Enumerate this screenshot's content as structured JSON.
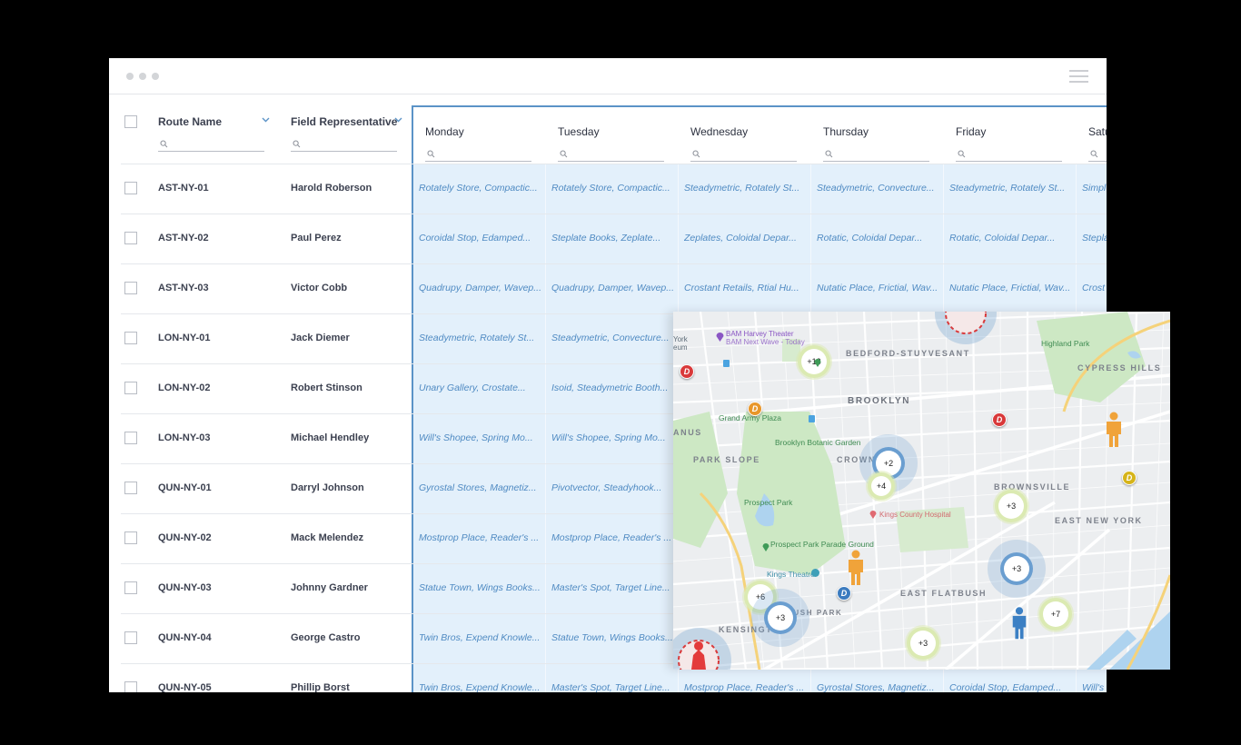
{
  "window": {
    "menu_icon": "hamburger-menu-icon"
  },
  "columns": {
    "route_name": "Route Name",
    "field_rep": "Field Representative",
    "days": [
      "Monday",
      "Tuesday",
      "Wednesday",
      "Thursday",
      "Friday",
      "Satu"
    ]
  },
  "rows": [
    {
      "route": "AST-NY-01",
      "rep": "Harold Roberson",
      "days": [
        "Rotately Store, Compactic...",
        "Rotately Store, Compactic...",
        "Steadymetric, Rotately St...",
        "Steadymetric, Convecture...",
        "Steadymetric, Rotately St...",
        "Simpl"
      ]
    },
    {
      "route": "AST-NY-02",
      "rep": "Paul Perez",
      "days": [
        "Coroidal Stop, Edamped...",
        "Steplate Books, Zeplate...",
        "Zeplates, Coloidal Depar...",
        "Rotatic, Coloidal Depar...",
        "Rotatic, Coloidal Depar...",
        "Stepla"
      ]
    },
    {
      "route": "AST-NY-03",
      "rep": "Victor Cobb",
      "days": [
        "Quadrupy, Damper, Wavep...",
        "Quadrupy, Damper, Wavep...",
        "Crostant Retails,  Rtial Hu...",
        "Nutatic Place, Frictial, Wav...",
        "Nutatic Place, Frictial, Wav...",
        "Crost"
      ]
    },
    {
      "route": "LON-NY-01",
      "rep": "Jack Diemer",
      "days": [
        "Steadymetric, Rotately St...",
        "Steadymetric, Convecture...",
        "",
        "",
        "",
        ""
      ]
    },
    {
      "route": "LON-NY-02",
      "rep": "Robert Stinson",
      "days": [
        "Unary Gallery, Crostate...",
        "Isoid, Steadymetric Booth...",
        "",
        "",
        "",
        ""
      ]
    },
    {
      "route": "LON-NY-03",
      "rep": "Michael Hendley",
      "days": [
        "Will's Shopee, Spring Mo...",
        "Will's Shopee, Spring Mo...",
        "",
        "",
        "",
        ""
      ]
    },
    {
      "route": "QUN-NY-01",
      "rep": "Darryl Johnson",
      "days": [
        "Gyrostal Stores, Magnetiz...",
        "Pivotvector, Steadyhook...",
        "",
        "",
        "",
        ""
      ]
    },
    {
      "route": "QUN-NY-02",
      "rep": "Mack Melendez",
      "days": [
        "Mostprop Place, Reader's ...",
        "Mostprop Place, Reader's ...",
        "",
        "",
        "",
        ""
      ]
    },
    {
      "route": "QUN-NY-03",
      "rep": "Johnny Gardner",
      "days": [
        "Statue Town, Wings Books...",
        "Master's Spot, Target Line...",
        "",
        "",
        "",
        ""
      ]
    },
    {
      "route": "QUN-NY-04",
      "rep": "George Castro",
      "days": [
        "Twin Bros, Expend Knowle...",
        "Statue Town, Wings Books...",
        "",
        "",
        "",
        ""
      ]
    },
    {
      "route": "QUN-NY-05",
      "rep": "Phillip Borst",
      "days": [
        "Twin Bros, Expend Knowle...",
        "Master's Spot, Target Line...",
        "Mostprop Place, Reader's ...",
        "Gyrostal Stores, Magnetiz...",
        "Coroidal Stop, Edamped...",
        "Will's"
      ]
    }
  ],
  "map": {
    "neighborhoods": [
      "BEDFORD-STUYVESANT",
      "BROOKLYN",
      "PARK SLOPE",
      "CROWN HE",
      "BROWNSVILLE",
      "EAST NEW YORK",
      "CYPRESS HILLS",
      "EAST FLATBUSH",
      "KENSINGTON",
      "BUSH PARK",
      "ANUS"
    ],
    "places": {
      "bam": "BAM Harvey Theater",
      "bam_sub": "BAM Next Wave - Today",
      "grand_army": "Grand Army Plaza",
      "botanic": "Brooklyn Botanic Garden",
      "prospect": "Prospect Park",
      "parade": "Prospect Park Parade Ground",
      "kings_theatre": "Kings Theatre",
      "hospital": "Kings County Hospital",
      "highland": "Highland Park",
      "york": "York",
      "york2": "eum"
    },
    "clusters": [
      {
        "label": "+13",
        "style": "green"
      },
      {
        "label": "+2",
        "style": "blue"
      },
      {
        "label": "+4",
        "style": "green"
      },
      {
        "label": "+3",
        "style": "green"
      },
      {
        "label": "+3",
        "style": "blue"
      },
      {
        "label": "+6",
        "style": "green"
      },
      {
        "label": "+3",
        "style": "blue"
      },
      {
        "label": "+7",
        "style": "green"
      },
      {
        "label": "+3",
        "style": "green"
      }
    ],
    "pins": [
      {
        "label": "D",
        "color": "#d9393a"
      },
      {
        "label": "D",
        "color": "#e8962a"
      },
      {
        "label": "D",
        "color": "#d9393a"
      },
      {
        "label": "D",
        "color": "#d6b41a"
      },
      {
        "label": "D",
        "color": "#3b7bbf"
      }
    ],
    "colors": {
      "person_orange": "#f0a33a",
      "person_blue": "#3c80c4",
      "park": "#cde8c4",
      "water": "#aed3ef",
      "highway": "#f5d27a"
    }
  }
}
